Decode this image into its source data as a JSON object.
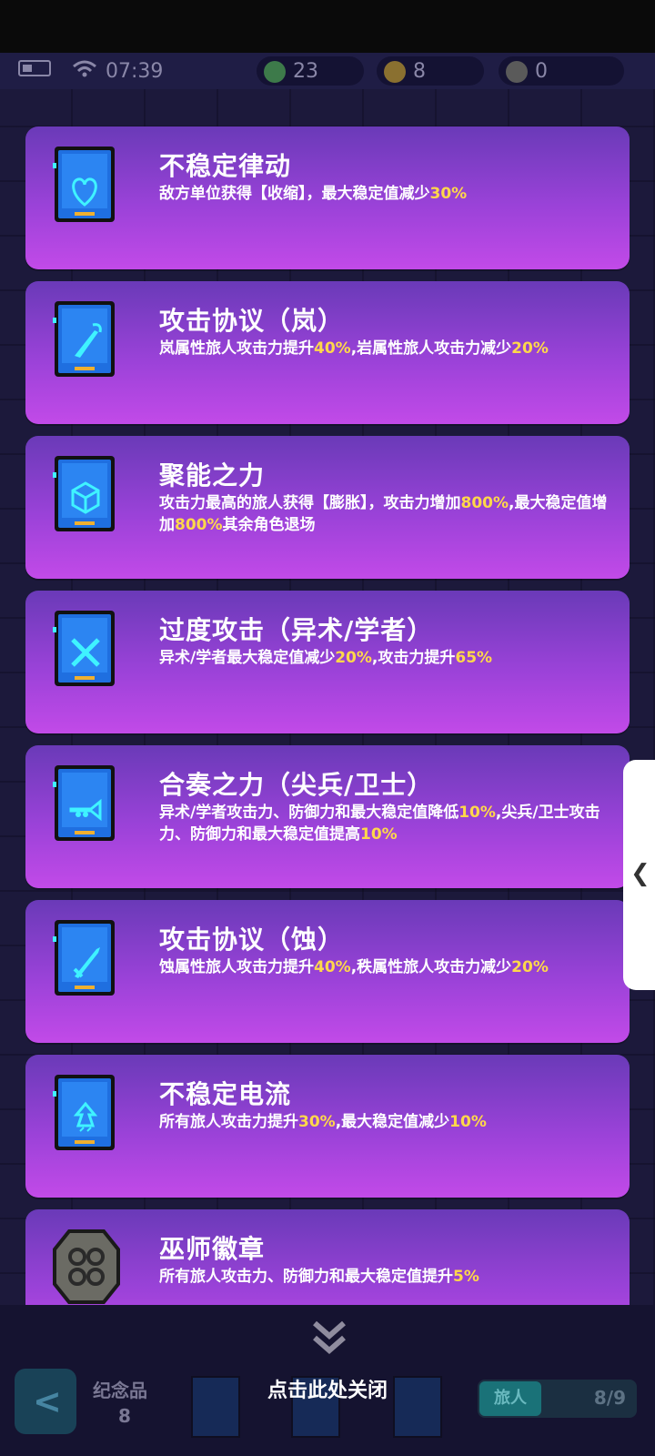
{
  "status": {
    "time": "07:39",
    "green_coins": "23",
    "gold_coins": "8",
    "dark_coins": "0"
  },
  "colors": {
    "highlight": "#ffd84a",
    "card_top": "#6a3ab8",
    "card_bottom": "#c24ae8"
  },
  "cards": [
    {
      "title": "不稳定律动",
      "icon": "heart-card-icon",
      "desc": [
        {
          "t": "敌方单位获得【收缩】，最大稳定值减少"
        },
        {
          "t": "30%",
          "hl": true
        }
      ]
    },
    {
      "title": "攻击协议（岚）",
      "icon": "dagger-card-icon",
      "desc": [
        {
          "t": "岚属性旅人攻击力提升"
        },
        {
          "t": "40%",
          "hl": true
        },
        {
          "t": ",岩属性旅人攻击力减少"
        },
        {
          "t": "20%",
          "hl": true
        }
      ]
    },
    {
      "title": "聚能之力",
      "icon": "cube-card-icon",
      "desc": [
        {
          "t": "攻击力最高的旅人获得【膨胀】，攻击力增加"
        },
        {
          "t": "800%",
          "hl": true
        },
        {
          "t": ",最大稳定值增加"
        },
        {
          "t": "800%",
          "hl": true
        },
        {
          "t": "其余角色退场"
        }
      ]
    },
    {
      "title": "过度攻击（异术/学者）",
      "icon": "crossed-swords-card-icon",
      "desc": [
        {
          "t": "异术/学者最大稳定值减少"
        },
        {
          "t": "20%",
          "hl": true
        },
        {
          "t": ",攻击力提升"
        },
        {
          "t": "65%",
          "hl": true
        }
      ]
    },
    {
      "title": "合奏之力（尖兵/卫士）",
      "icon": "trumpet-card-icon",
      "desc": [
        {
          "t": "异术/学者攻击力、防御力和最大稳定值降低"
        },
        {
          "t": "10%",
          "hl": true
        },
        {
          "t": ",尖兵/卫士攻击力、防御力和最大稳定值提高"
        },
        {
          "t": "10%",
          "hl": true
        }
      ]
    },
    {
      "title": "攻击协议（蚀）",
      "icon": "sword-card-icon",
      "desc": [
        {
          "t": "蚀属性旅人攻击力提升"
        },
        {
          "t": "40%",
          "hl": true
        },
        {
          "t": ",秩属性旅人攻击力减少"
        },
        {
          "t": "20%",
          "hl": true
        }
      ]
    },
    {
      "title": "不稳定电流",
      "icon": "bolt-card-icon",
      "desc": [
        {
          "t": "所有旅人攻击力提升"
        },
        {
          "t": "30%",
          "hl": true
        },
        {
          "t": ",最大稳定值减少"
        },
        {
          "t": "10%",
          "hl": true
        }
      ]
    },
    {
      "title": "巫师徽章",
      "icon": "badge-icon",
      "desc": [
        {
          "t": "所有旅人攻击力、防御力和最大稳定值提升"
        },
        {
          "t": "5%",
          "hl": true
        }
      ]
    }
  ],
  "close_label": "点击此处关闭",
  "bottom": {
    "souvenir_label": "纪念品",
    "souvenir_count": "8",
    "traveler_label": "旅人",
    "traveler_count": "8/9"
  }
}
